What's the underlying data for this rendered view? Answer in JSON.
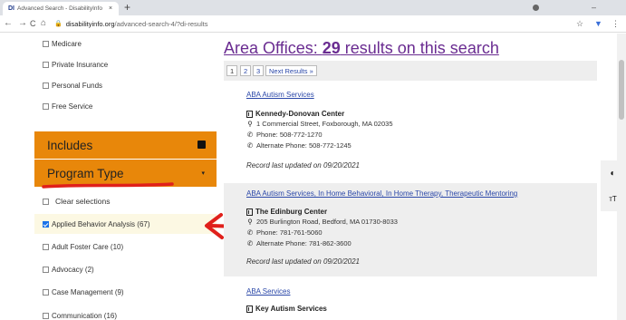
{
  "browser": {
    "tab_favicon": "DI",
    "tab_title": "Advanced Search - DisabilityInfo",
    "tab_close": "×",
    "new_tab": "+",
    "back": "←",
    "forward": "→",
    "reload": "C",
    "home": "⌂",
    "lock": "🔒",
    "url_domain": "disabilityinfo.org",
    "url_path": "/advanced-search-4/?di-results",
    "star": "☆",
    "menu": "⋮"
  },
  "sidebar": {
    "payment_items": [
      {
        "label": "Medicare"
      },
      {
        "label": "Private Insurance"
      },
      {
        "label": "Personal Funds"
      },
      {
        "label": "Free Service"
      }
    ],
    "includes_label": "Includes",
    "program_type_label": "Program Type",
    "caret": "▾",
    "clear_label": "Clear selections",
    "program_items": [
      {
        "label": "Applied Behavior Analysis (67)",
        "checked": true
      },
      {
        "label": "Adult Foster Care (10)",
        "checked": false
      },
      {
        "label": "Advocacy (2)",
        "checked": false
      },
      {
        "label": "Case Management (9)",
        "checked": false
      },
      {
        "label": "Communication (16)",
        "checked": false
      }
    ]
  },
  "main": {
    "title_prefix": "Area Offices: ",
    "title_count": "29",
    "title_suffix": " results on this search",
    "pages": [
      "1",
      "2",
      "3"
    ],
    "next_label": "Next Results »",
    "results": [
      {
        "link": "ABA Autism Services",
        "name": "Kennedy-Donovan Center",
        "address": "1 Commercial Street, Foxborough, MA 02035",
        "phone": "Phone: 508-772-1270",
        "alt_phone": "Alternate Phone: 508-772-1245",
        "updated": "Record last updated on 09/20/2021"
      },
      {
        "link": "ABA Autism Services, In Home Behavioral, In Home Therapy, Therapeutic Mentoring",
        "name": "The Edinburg Center",
        "address": "205 Burlington Road, Bedford, MA 01730-8033",
        "phone": "Phone: 781-761-5060",
        "alt_phone": "Alternate Phone: 781-862-3600",
        "updated": "Record last updated on 09/20/2021"
      },
      {
        "link": "ABA Services",
        "name": "Key Autism Services"
      }
    ]
  },
  "icons": {
    "contrast": "◐",
    "text_size": "тT",
    "pin": "⚲",
    "phone": "✆"
  },
  "colors": {
    "accent_orange": "#e8870a",
    "title_purple": "#6a2c91",
    "link_blue": "#2a47a8",
    "annotation_red": "#e0201b",
    "highlight_yellow": "#fcf8e3"
  }
}
